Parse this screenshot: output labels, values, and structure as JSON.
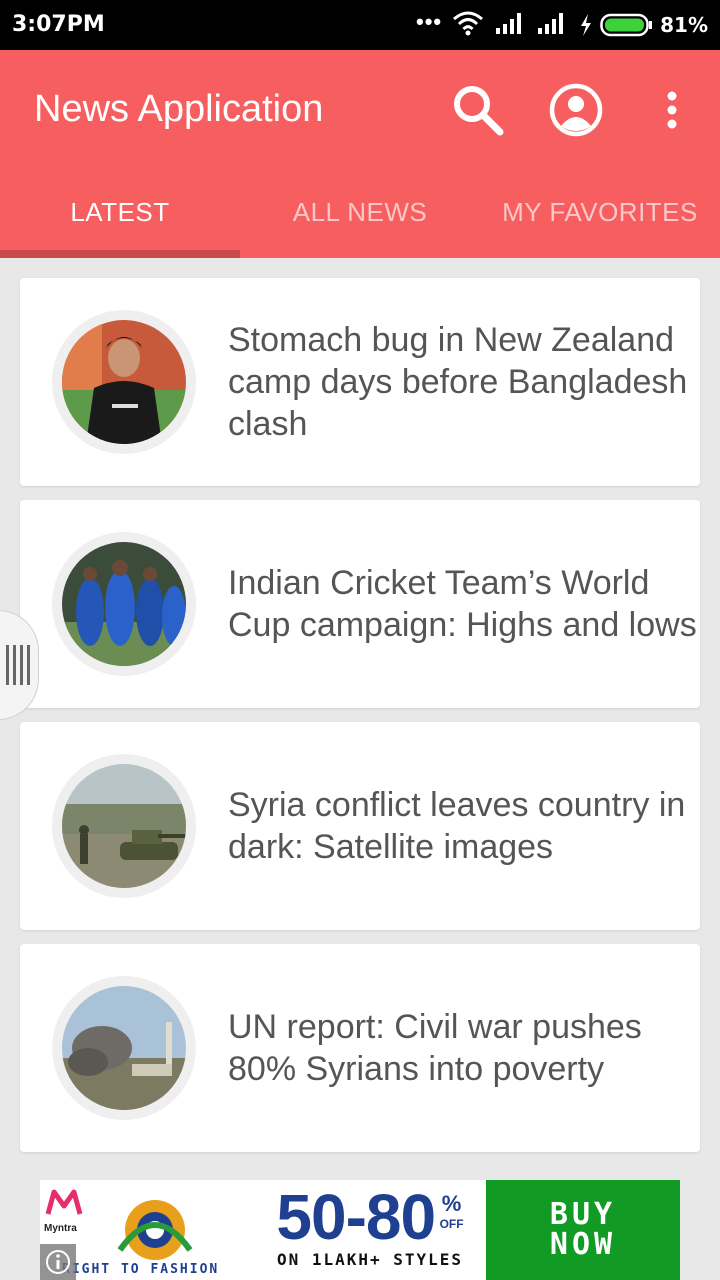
{
  "status_bar": {
    "time": "3:07PM",
    "dots": "•••",
    "battery_percent": "81%"
  },
  "app_bar": {
    "title": "News Application",
    "icons": [
      "search-icon",
      "account-icon",
      "overflow-menu-icon"
    ]
  },
  "tabs": [
    {
      "label": "LATEST",
      "active": true
    },
    {
      "label": "ALL NEWS",
      "active": false
    },
    {
      "label": "MY FAVORITES",
      "active": false
    }
  ],
  "articles": [
    {
      "headline": "Stomach bug in New Zealand camp days before Bangladesh clash",
      "image": "cricket-player-photo"
    },
    {
      "headline": "Indian Cricket Team’s World Cup campaign: Highs and lows",
      "image": "cricket-team-photo"
    },
    {
      "headline": "Syria conflict leaves country in dark: Satellite images",
      "image": "tank-photo"
    },
    {
      "headline": "UN report: Civil war pushes 80% Syrians into poverty",
      "image": "smoke-city-photo"
    }
  ],
  "ad": {
    "brand": "Myntra",
    "offer": "50-80",
    "percent": "%",
    "off": "OFF",
    "styles": "ON 1LAKH+ STYLES",
    "tagline": "RIGHT TO FASHION",
    "cta_line1": "BUY",
    "cta_line2": "NOW"
  },
  "colors": {
    "app_bar": "#f65e5f",
    "tab_indicator": "#c94b4c",
    "headline_text": "#555555",
    "cta": "#119a24"
  }
}
